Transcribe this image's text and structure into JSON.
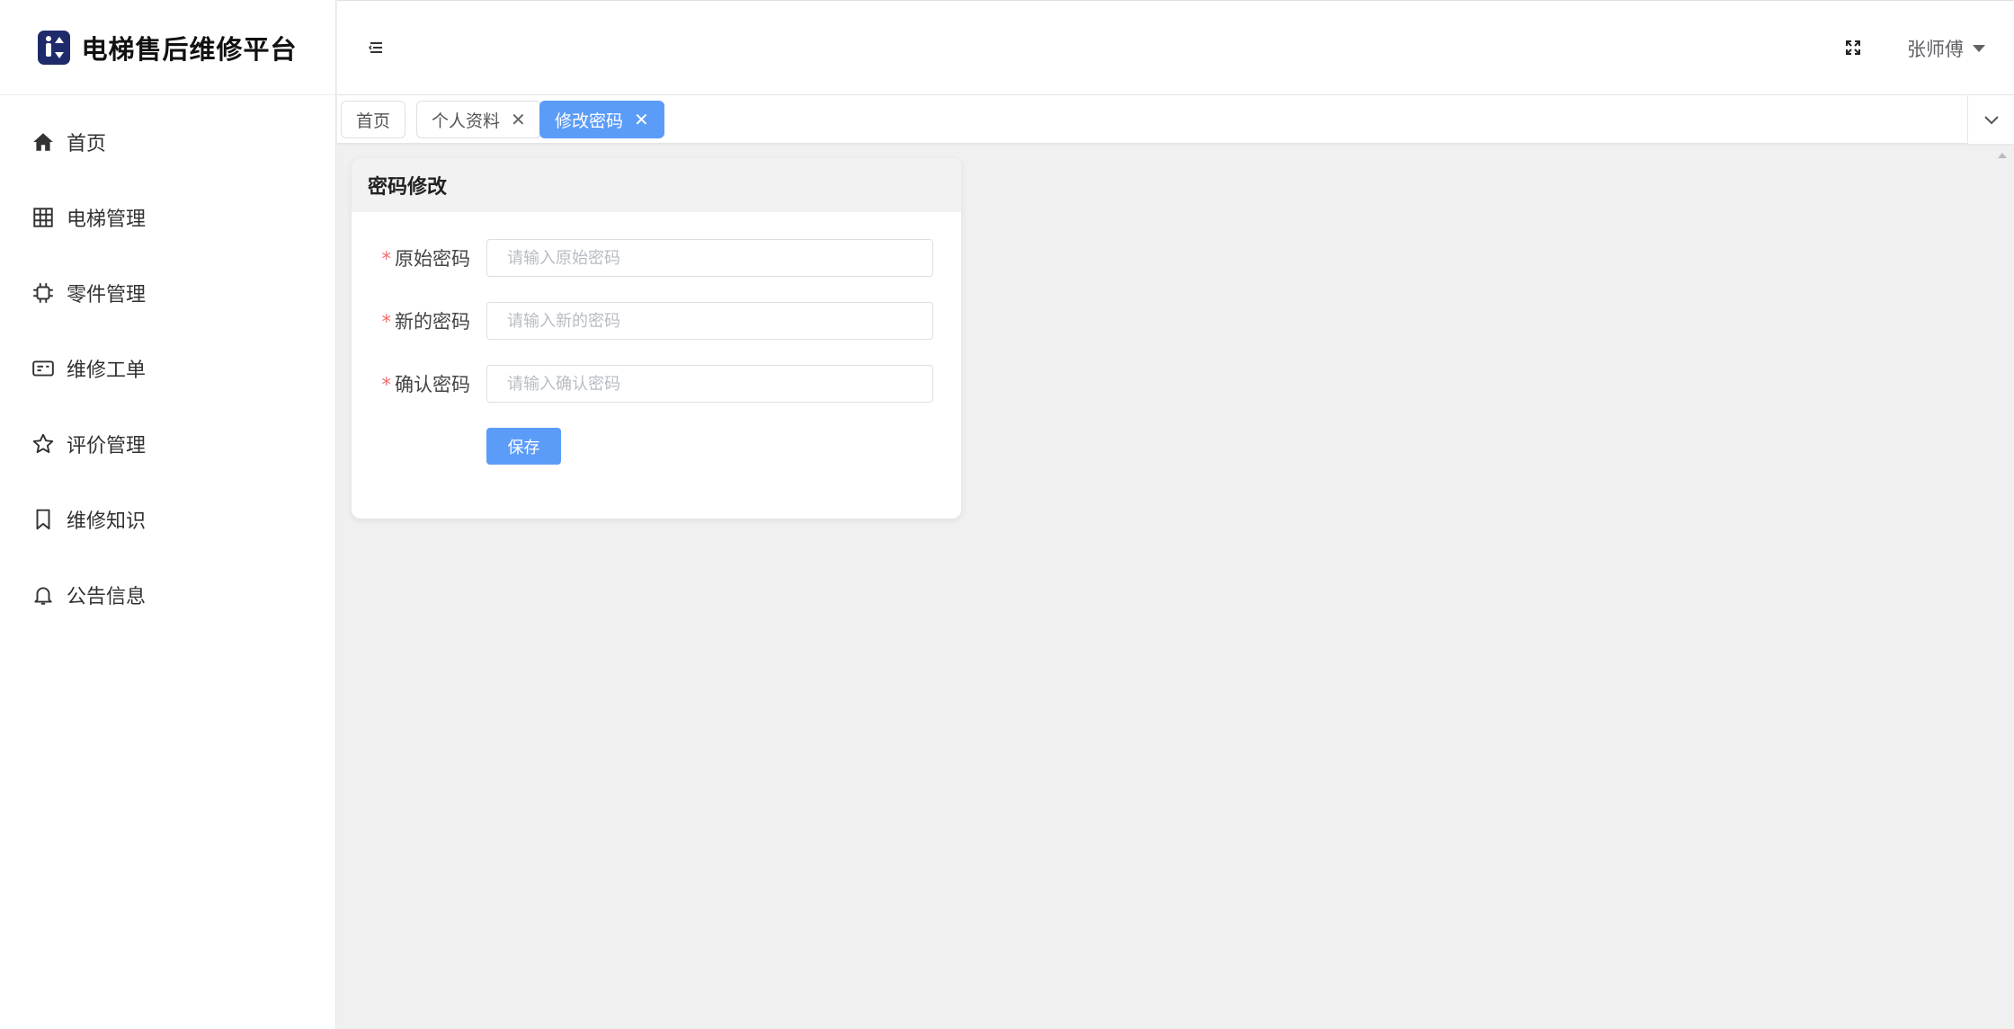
{
  "app": {
    "title": "电梯售后维修平台"
  },
  "sidebar": {
    "items": [
      {
        "label": "首页",
        "icon": "home-icon"
      },
      {
        "label": "电梯管理",
        "icon": "grid-icon"
      },
      {
        "label": "零件管理",
        "icon": "chip-icon"
      },
      {
        "label": "维修工单",
        "icon": "ticket-icon"
      },
      {
        "label": "评价管理",
        "icon": "star-icon"
      },
      {
        "label": "维修知识",
        "icon": "bookmark-icon"
      },
      {
        "label": "公告信息",
        "icon": "bell-icon"
      }
    ]
  },
  "header": {
    "user_name": "张师傅"
  },
  "tabs": [
    {
      "label": "首页",
      "closable": false,
      "active": false
    },
    {
      "label": "个人资料",
      "closable": true,
      "active": false
    },
    {
      "label": "修改密码",
      "closable": true,
      "active": true
    }
  ],
  "password_form": {
    "title": "密码修改",
    "fields": [
      {
        "label": "原始密码",
        "placeholder": "请输入原始密码",
        "required": true,
        "value": ""
      },
      {
        "label": "新的密码",
        "placeholder": "请输入新的密码",
        "required": true,
        "value": ""
      },
      {
        "label": "确认密码",
        "placeholder": "请输入确认密码",
        "required": true,
        "value": ""
      }
    ],
    "required_mark": "*",
    "save_label": "保存"
  },
  "colors": {
    "accent": "#5b9cf8",
    "logo_bg": "#1f2a6b",
    "required": "#f56c6c",
    "page_bg": "#f0f0f0"
  }
}
